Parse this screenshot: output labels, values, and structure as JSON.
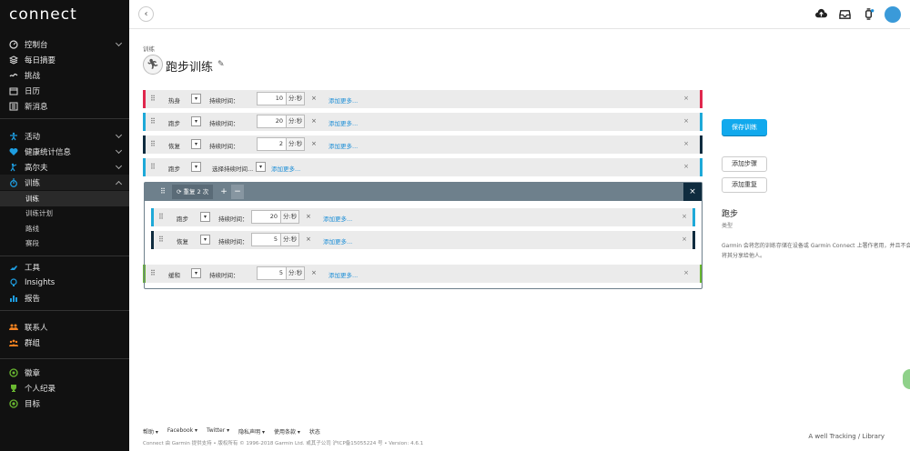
{
  "app": {
    "logo": "connect"
  },
  "sidebar": {
    "group1": [
      {
        "label": "控制台",
        "icon": "dashboard-icon",
        "chevron": "down"
      },
      {
        "label": "每日摘要",
        "icon": "layers-icon"
      },
      {
        "label": "挑战",
        "icon": "challenge-icon"
      },
      {
        "label": "日历",
        "icon": "calendar-icon"
      },
      {
        "label": "新消息",
        "icon": "newsfeed-icon"
      }
    ],
    "group2": [
      {
        "label": "活动",
        "icon": "activity-icon",
        "chevron": "down"
      },
      {
        "label": "健康统计信息",
        "icon": "heart-icon",
        "chevron": "down"
      },
      {
        "label": "高尔夫",
        "icon": "golf-icon",
        "chevron": "down"
      },
      {
        "label": "训练",
        "icon": "stopwatch-icon",
        "chevron": "up"
      }
    ],
    "training_sub": [
      {
        "label": "训练",
        "current": true
      },
      {
        "label": "训练计划"
      },
      {
        "label": "路线"
      },
      {
        "label": "赛段"
      }
    ],
    "group3": [
      {
        "label": "工具",
        "icon": "tools-icon"
      },
      {
        "label": "Insights",
        "icon": "lightbulb-icon"
      },
      {
        "label": "报告",
        "icon": "report-icon"
      }
    ],
    "group4": [
      {
        "label": "联系人",
        "icon": "contacts-icon"
      },
      {
        "label": "群组",
        "icon": "groups-icon"
      }
    ],
    "group5": [
      {
        "label": "徽章",
        "icon": "badge-icon"
      },
      {
        "label": "个人纪录",
        "icon": "trophy-icon"
      },
      {
        "label": "目标",
        "icon": "target-icon"
      }
    ]
  },
  "topbar": {
    "back": "‹"
  },
  "page": {
    "breadcrumb": "训练",
    "title": "跑步训练",
    "pencil": "✎"
  },
  "steps": [
    {
      "type": "热身",
      "duration_label": "持续时间：",
      "value": "10",
      "unit": "分:秒",
      "x": "×",
      "add_more": "添加更多...",
      "xr": "×",
      "color": "#e0284e"
    },
    {
      "type": "跑步",
      "duration_label": "持续时间：",
      "value": "20",
      "unit": "分:秒",
      "x": "×",
      "add_more": "添加更多...",
      "xr": "×",
      "color": "#1ea9d8"
    },
    {
      "type": "恢复",
      "duration_label": "持续时间：",
      "value": "2",
      "unit": "分:秒",
      "x": "×",
      "add_more": "添加更多...",
      "xr": "×",
      "color": "#0f2c3f"
    },
    {
      "type": "跑步",
      "duration_label": "选择持续时间...",
      "add_more": "添加更多...",
      "xr": "×",
      "color": "#1ea9d8"
    }
  ],
  "repeat": {
    "label": "重复 2 次",
    "plus": "+",
    "minus": "−",
    "close": "×",
    "steps": [
      {
        "type": "跑步",
        "duration_label": "持续时间：",
        "value": "20",
        "unit": "分:秒",
        "x": "×",
        "add_more": "添加更多...",
        "xr": "×",
        "color": "#1ea9d8"
      },
      {
        "type": "恢复",
        "duration_label": "持续时间：",
        "value": "5",
        "unit": "分:秒",
        "x": "×",
        "add_more": "添加更多...",
        "xr": "×",
        "color": "#0f2c3f"
      }
    ]
  },
  "cooldown": {
    "type": "缓和",
    "duration_label": "持续时间：",
    "value": "5",
    "unit": "分:秒",
    "x": "×",
    "add_more": "添加更多...",
    "xr": "×",
    "color": "#6ab931"
  },
  "actions": {
    "save": "保存训练",
    "add_step": "添加步骤",
    "add_repeat": "添加重复"
  },
  "info": {
    "title": "跑步",
    "subtitle": "类型",
    "text": "Garmin 会将您的训练存储在设备或 Garmin Connect 上署作者用，并且不会将其分享给他人。"
  },
  "footer": {
    "links": [
      "帮助 ▾",
      "Facebook ▾",
      "Twitter ▾",
      "隐私声明 ▾",
      "使用条款 ▾",
      "状态"
    ],
    "copy": "Connect 由 Garmin  提供支持 • 版权所有 © 1996-2018 Garmin Ltd. 或其子公司  沪ICP备15055224  号 • Version: 4.6.1",
    "right": "A  well  Tracking  / Library"
  }
}
